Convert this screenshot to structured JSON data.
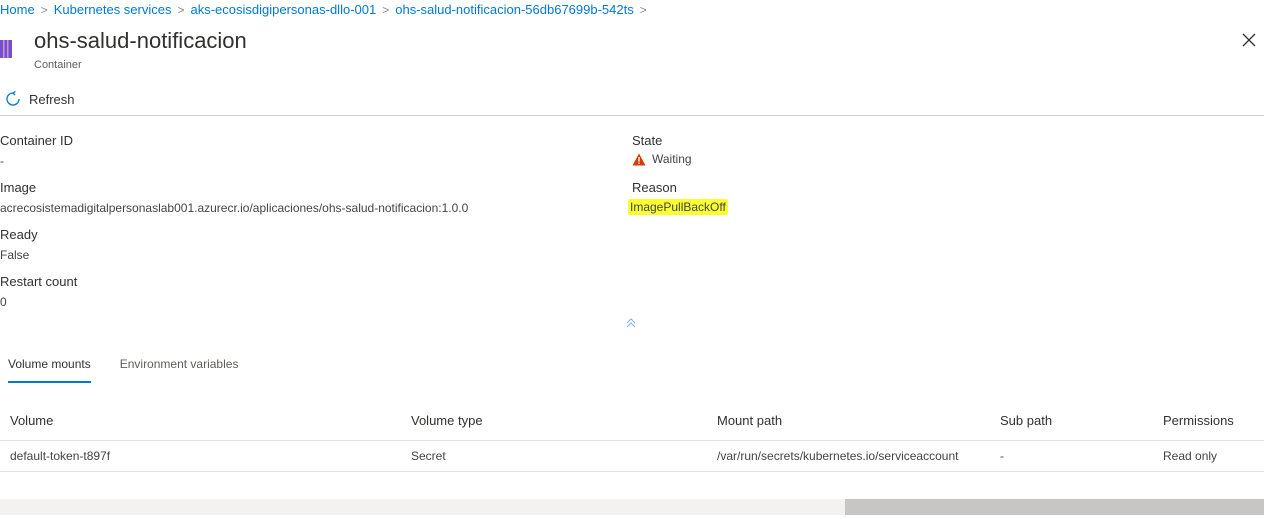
{
  "breadcrumb": [
    {
      "label": "Home"
    },
    {
      "label": "Kubernetes services"
    },
    {
      "label": "aks-ecosisdigipersonas-dllo-001"
    },
    {
      "label": "ohs-salud-notificacion-56db67699b-542ts"
    }
  ],
  "header": {
    "title": "ohs-salud-notificacion",
    "subtitle": "Container"
  },
  "toolbar": {
    "refresh_label": "Refresh"
  },
  "details": {
    "container_id": {
      "label": "Container ID",
      "value": "-"
    },
    "image": {
      "label": "Image",
      "value": "acrecosistemadigitalpersonaslab001.azurecr.io/aplicaciones/ohs-salud-notificacion:1.0.0"
    },
    "ready": {
      "label": "Ready",
      "value": "False"
    },
    "restart_count": {
      "label": "Restart count",
      "value": "0"
    },
    "state": {
      "label": "State",
      "value": "Waiting"
    },
    "reason": {
      "label": "Reason",
      "value": "ImagePullBackOff"
    }
  },
  "tabs": [
    {
      "label": "Volume mounts",
      "active": true
    },
    {
      "label": "Environment variables",
      "active": false
    }
  ],
  "table": {
    "columns": [
      "Volume",
      "Volume type",
      "Mount path",
      "Sub path",
      "Permissions"
    ],
    "rows": [
      [
        "default-token-t897f",
        "Secret",
        "/var/run/secrets/kubernetes.io/serviceaccount",
        "-",
        "Read only"
      ]
    ]
  },
  "colors": {
    "accent": "#0078d4",
    "warning": "#d83b01",
    "highlight": "#fcff2f",
    "icon": "#7b4fc4"
  },
  "icons": {
    "resource": "container-icon",
    "refresh": "refresh-icon",
    "close": "close-icon",
    "warning": "warning-icon",
    "collapse": "chevron-up-double-icon"
  }
}
